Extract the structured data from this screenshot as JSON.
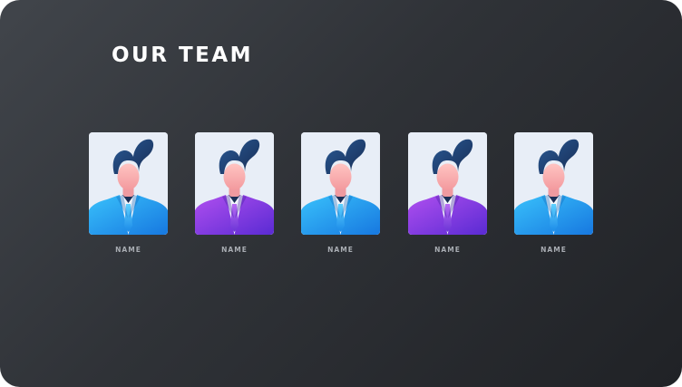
{
  "slide": {
    "title": "OUR TEAM"
  },
  "team": {
    "members": [
      {
        "name": "NAME",
        "suit": "blue"
      },
      {
        "name": "NAME",
        "suit": "purple"
      },
      {
        "name": "NAME",
        "suit": "blue"
      },
      {
        "name": "NAME",
        "suit": "purple"
      },
      {
        "name": "NAME",
        "suit": "blue"
      }
    ]
  },
  "colors": {
    "background_light": "#41454b",
    "background_dark": "#202226",
    "card_background": "#e8eef7",
    "hair": "#1f3a66",
    "skin": "#f7b3b3",
    "suit_blue": "#1aa2f0",
    "suit_purple": "#8a3cdc",
    "title": "#ffffff",
    "label": "#a9adb3"
  },
  "icons": [
    "avatar-illustration"
  ]
}
